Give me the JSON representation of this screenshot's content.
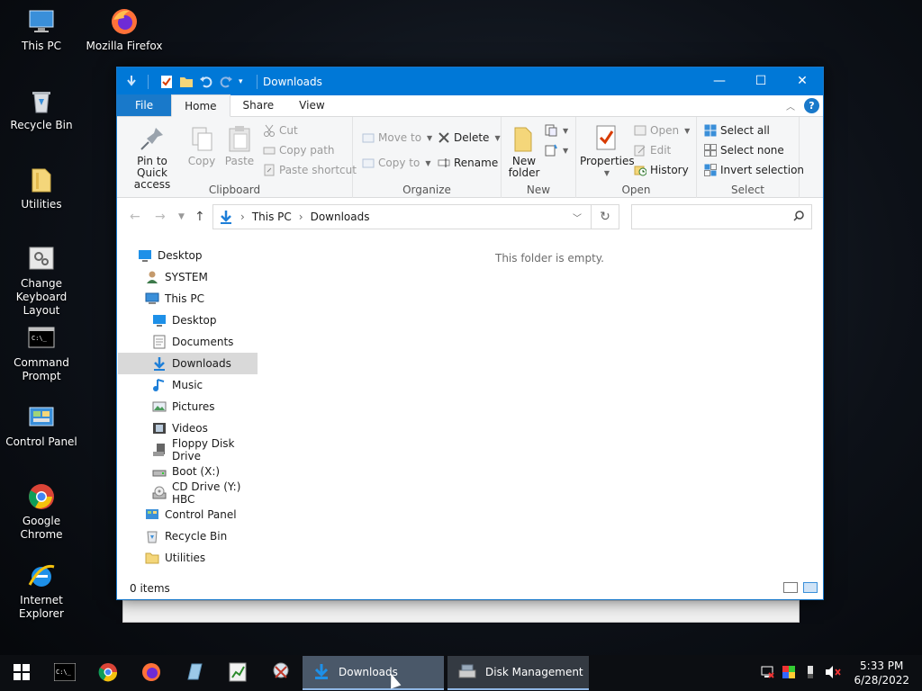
{
  "desktop": {
    "icons": [
      {
        "label": "This PC"
      },
      {
        "label": "Mozilla Firefox"
      },
      {
        "label": "Recycle Bin"
      },
      {
        "label": "Utilities"
      },
      {
        "label": "Change Keyboard Layout"
      },
      {
        "label": "Command Prompt"
      },
      {
        "label": "Control Panel"
      },
      {
        "label": "Google Chrome"
      },
      {
        "label": "Internet Explorer"
      }
    ]
  },
  "window": {
    "title": "Downloads",
    "caption": {
      "minimize": "—",
      "maximize": "☐",
      "close": "✕"
    },
    "tabs": {
      "file": "File",
      "home": "Home",
      "share": "Share",
      "view": "View"
    },
    "ribbon": {
      "clipboard": {
        "name": "Clipboard",
        "pin": "Pin to Quick access",
        "copy": "Copy",
        "paste": "Paste",
        "cut": "Cut",
        "copy_path": "Copy path",
        "paste_shortcut": "Paste shortcut"
      },
      "organize": {
        "name": "Organize",
        "move_to": "Move to",
        "copy_to": "Copy to",
        "delete": "Delete",
        "rename": "Rename"
      },
      "new": {
        "name": "New",
        "new_folder": "New folder"
      },
      "open": {
        "name": "Open",
        "properties": "Properties",
        "open": "Open",
        "edit": "Edit",
        "history": "History"
      },
      "select": {
        "name": "Select",
        "select_all": "Select all",
        "select_none": "Select none",
        "invert": "Invert selection"
      }
    },
    "address": {
      "crumbs": [
        "This PC",
        "Downloads"
      ],
      "search_placeholder": ""
    },
    "nav": [
      {
        "label": "Desktop",
        "icon": "desktop-icon"
      },
      {
        "label": "SYSTEM",
        "icon": "user-icon"
      },
      {
        "label": "This PC",
        "icon": "computer-icon"
      },
      {
        "label": "Desktop",
        "icon": "desktop-icon"
      },
      {
        "label": "Documents",
        "icon": "documents-icon"
      },
      {
        "label": "Downloads",
        "icon": "downloads-icon"
      },
      {
        "label": "Music",
        "icon": "music-icon"
      },
      {
        "label": "Pictures",
        "icon": "pictures-icon"
      },
      {
        "label": "Videos",
        "icon": "videos-icon"
      },
      {
        "label": "Floppy Disk Drive",
        "icon": "floppy-icon"
      },
      {
        "label": "Boot (X:)",
        "icon": "drive-icon"
      },
      {
        "label": "CD Drive (Y:) HBC",
        "icon": "cd-drive-icon"
      },
      {
        "label": "Control Panel",
        "icon": "control-panel-icon"
      },
      {
        "label": "Recycle Bin",
        "icon": "recycle-bin-icon"
      },
      {
        "label": "Utilities",
        "icon": "folder-icon"
      }
    ],
    "empty_message": "This folder is empty.",
    "status": "0 items"
  },
  "taskbar": {
    "tasks": [
      {
        "label": "Downloads"
      },
      {
        "label": "Disk Management"
      }
    ],
    "time": "5:33 PM",
    "date": "6/28/2022"
  },
  "colors": {
    "accent": "#0078d7",
    "file_tab": "#1979ca"
  }
}
